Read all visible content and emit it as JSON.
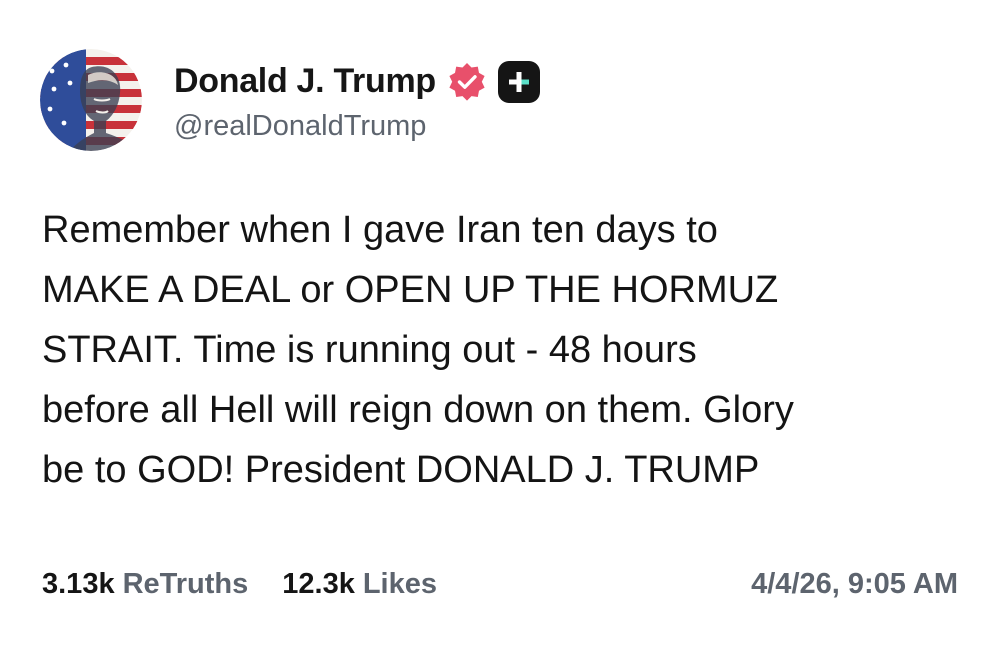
{
  "post": {
    "author": {
      "display_name": "Donald J. Trump",
      "handle": "@realDonaldTrump",
      "avatar_icon": "flag-portrait-avatar",
      "verified_icon": "verified-badge-icon",
      "badge_icon": "plus-badge-icon"
    },
    "text_lines": [
      "Remember when I gave Iran ten days to",
      "MAKE A DEAL or OPEN UP THE HORMUZ",
      "STRAIT. Time is running out - 48 hours",
      "before all Hell will reign down on them. Glory",
      "be to GOD! President DONALD J. TRUMP"
    ],
    "stats": {
      "retruths_count": "3.13k",
      "retruths_label": "ReTruths",
      "likes_count": "12.3k",
      "likes_label": "Likes"
    },
    "timestamp": "4/4/26, 9:05 AM"
  },
  "colors": {
    "verified_badge": "#e8506b",
    "plus_badge_bg": "#151515",
    "plus_badge_accent": "#5be0c8",
    "muted_text": "#5d646e",
    "primary_text": "#141414"
  }
}
